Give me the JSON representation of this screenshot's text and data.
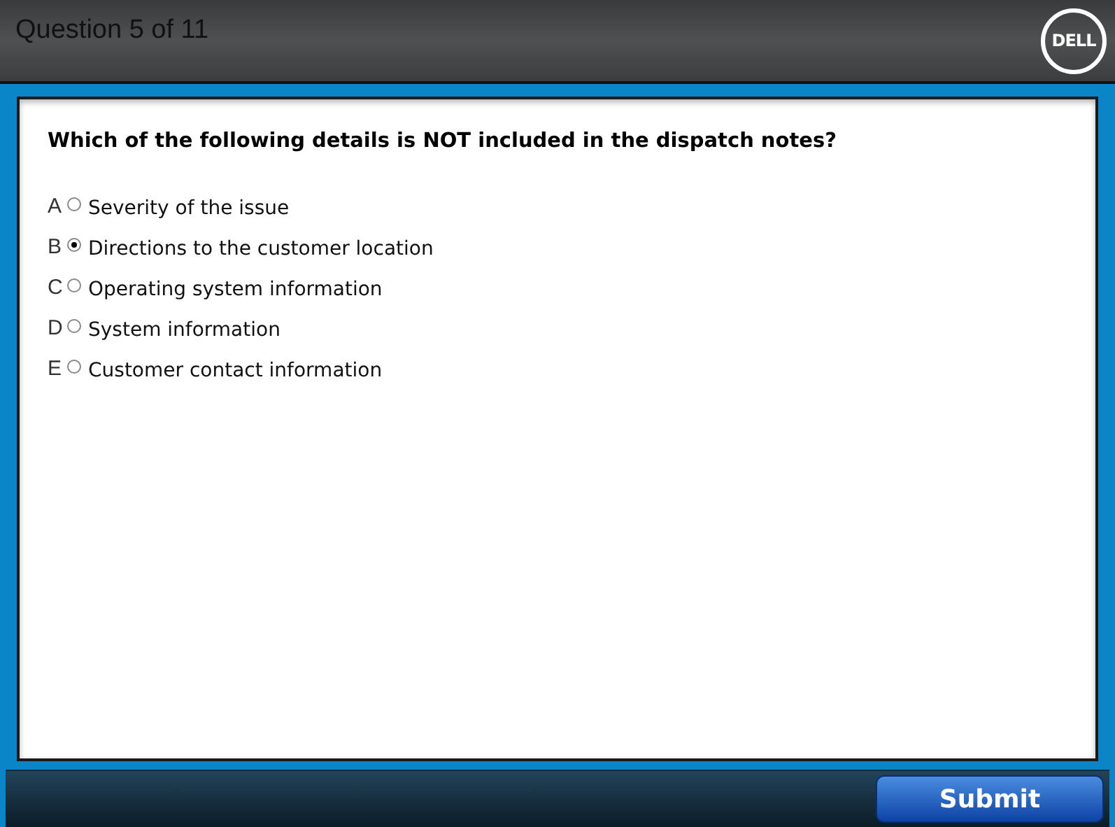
{
  "header": {
    "title": "Question 5 of 11",
    "logo": "DELL"
  },
  "question": {
    "text": "Which of the following details is NOT included in the dispatch notes?",
    "options": [
      {
        "letter": "A",
        "label": "Severity of the issue",
        "selected": false
      },
      {
        "letter": "B",
        "label": "Directions to the customer location",
        "selected": true
      },
      {
        "letter": "C",
        "label": "Operating system information",
        "selected": false
      },
      {
        "letter": "D",
        "label": "System information",
        "selected": false
      },
      {
        "letter": "E",
        "label": "Customer contact information",
        "selected": false
      }
    ]
  },
  "footer": {
    "button": "Submit"
  }
}
